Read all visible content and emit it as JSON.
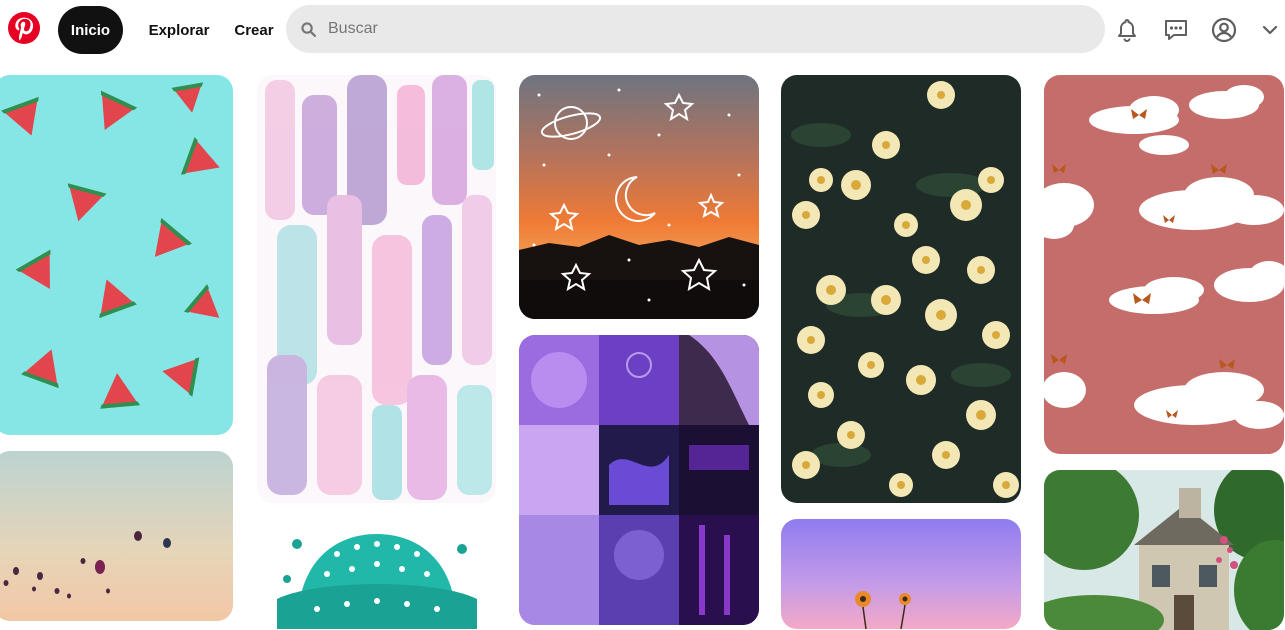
{
  "header": {
    "logo_icon": "pinterest-logo-icon",
    "nav": {
      "home_label": "Inicio",
      "explore_label": "Explorar",
      "create_label": "Crear"
    },
    "search": {
      "placeholder": "Buscar",
      "value": "",
      "icon": "search-icon"
    },
    "icons": [
      "bell-icon",
      "chat-icon",
      "user-icon",
      "chevron-down-icon"
    ]
  },
  "brand_color": "#e60023",
  "pins": [
    {
      "name": "watermelon",
      "colors": [
        "#7fe3e3",
        "#e2454c"
      ]
    },
    {
      "name": "balloons",
      "colors": [
        "#c9d6cf",
        "#efc6a8"
      ]
    },
    {
      "name": "pastel-brush",
      "colors": [
        "#d7b6e4",
        "#b7e5e6"
      ]
    },
    {
      "name": "teal-bucket-hat",
      "colors": [
        "#1bb6a9",
        "#ffffff"
      ]
    },
    {
      "name": "orange-sky-stars",
      "colors": [
        "#e87a3e",
        "#1a1a1a"
      ]
    },
    {
      "name": "purple-collage",
      "colors": [
        "#8d5fd8",
        "#3a1a6e"
      ]
    },
    {
      "name": "daisies",
      "colors": [
        "#1f2a26",
        "#f2e6b3"
      ]
    },
    {
      "name": "purple-sky-flowers",
      "colors": [
        "#9b7ee8",
        "#f2a3c3"
      ]
    },
    {
      "name": "pink-clouds-butterflies",
      "colors": [
        "#c86c6c",
        "#ffffff"
      ]
    },
    {
      "name": "stone-cottage",
      "colors": [
        "#3f7a35",
        "#d9d3c0"
      ]
    }
  ]
}
